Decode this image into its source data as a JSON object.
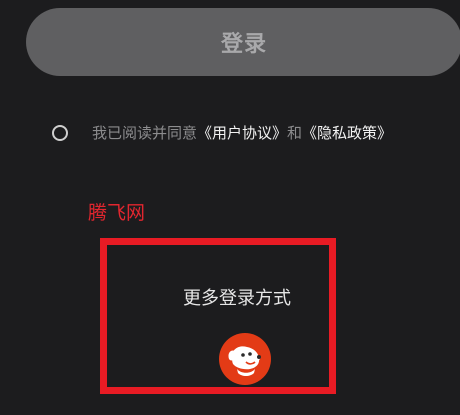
{
  "login": {
    "button_label": "登录"
  },
  "agreement": {
    "prefix": "我已阅读并同意",
    "user_agreement": "《用户协议》",
    "and": "和",
    "privacy_policy": "《隐私政策》"
  },
  "watermark": {
    "text": "腾飞网",
    "color": "#e2262f"
  },
  "more_login": {
    "label": "更多登录方式",
    "icons": [
      "jd-dog-icon"
    ]
  },
  "colors": {
    "background": "#1c1c1e",
    "button_bg": "#5f5f61",
    "highlight_border": "#e81b24",
    "jd_red": "#e33b16"
  }
}
